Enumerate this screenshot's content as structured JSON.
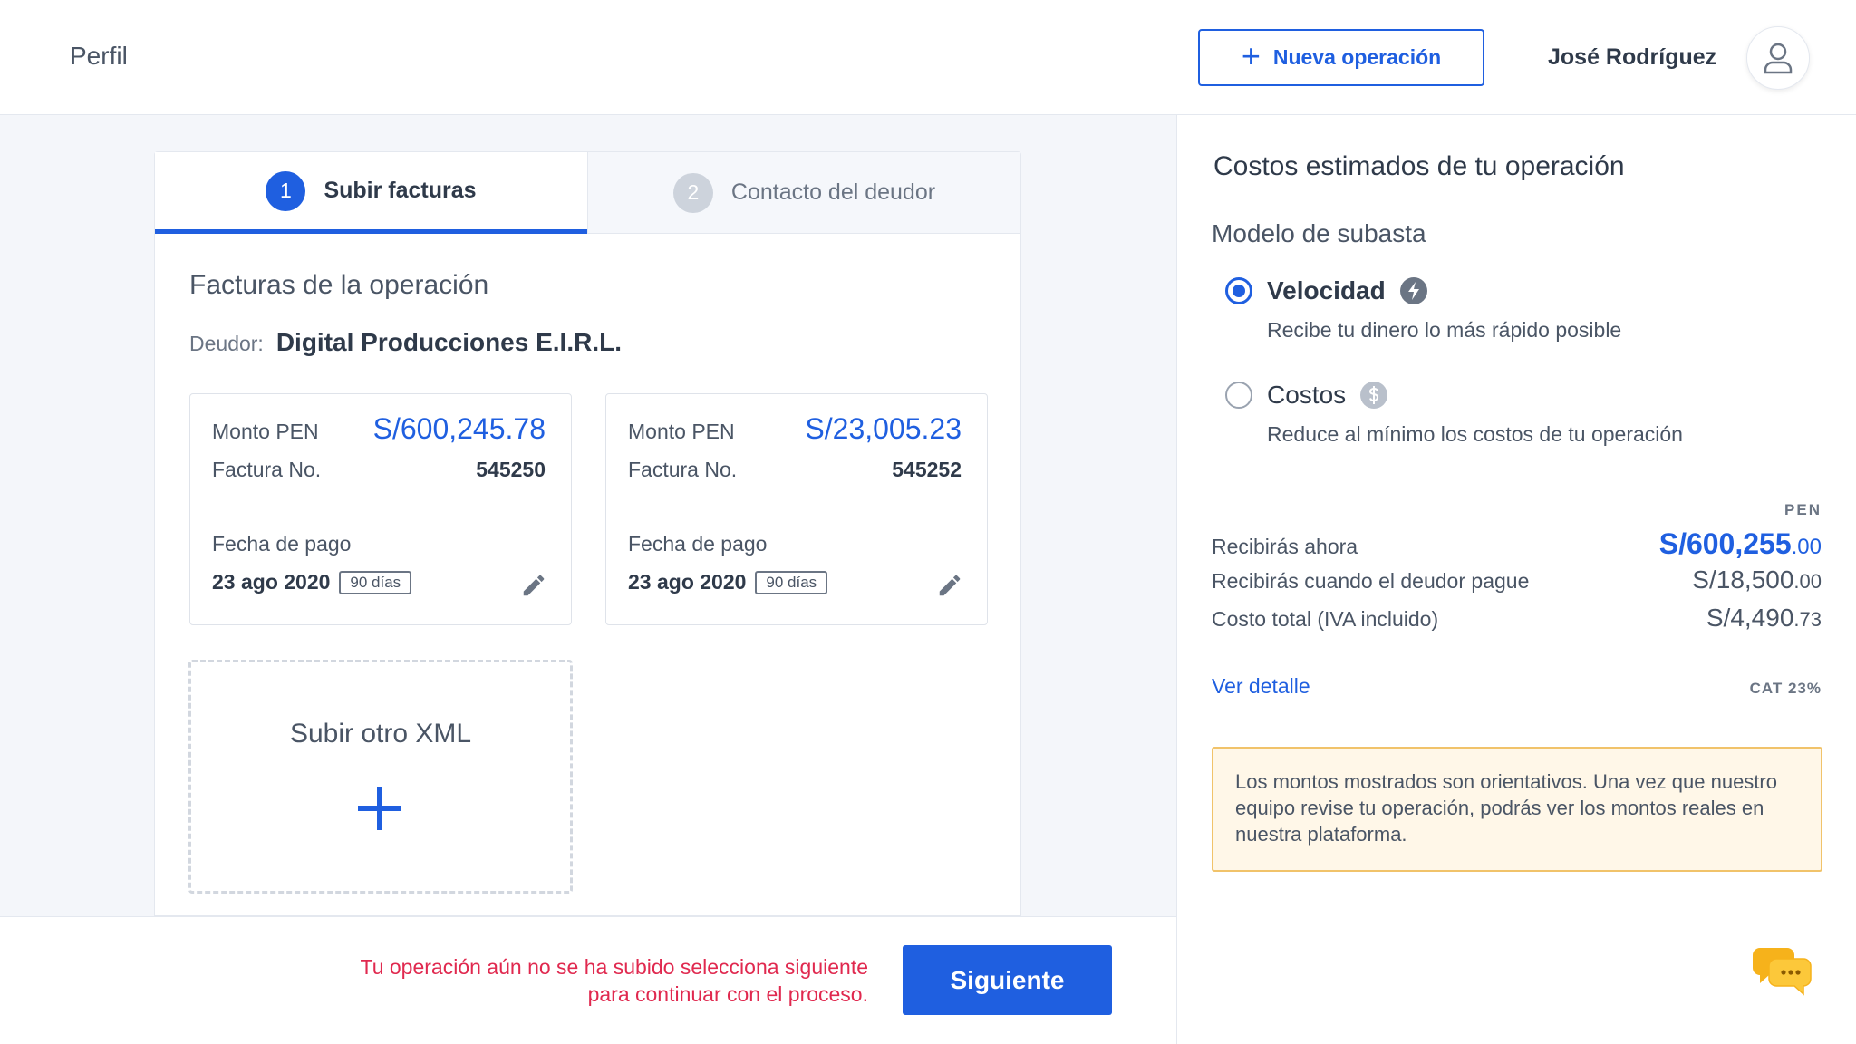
{
  "header": {
    "profile_label": "Perfil",
    "new_operation_label": "Nueva operación",
    "user_name": "José Rodríguez",
    "accent_color": "#1f5fe0"
  },
  "steps": [
    {
      "number": "1",
      "label": "Subir facturas",
      "active": true
    },
    {
      "number": "2",
      "label": "Contacto del deudor",
      "active": false
    }
  ],
  "main": {
    "section_title": "Facturas de la operación",
    "debtor_label": "Deudor:",
    "debtor_name": "Digital Producciones E.I.R.L.",
    "invoices": [
      {
        "amount_label": "Monto PEN",
        "amount": "S/600,245.78",
        "number_label": "Factura No.",
        "number": "545250",
        "pay_label": "Fecha de pago",
        "pay_date": "23 ago 2020",
        "days": "90 días"
      },
      {
        "amount_label": "Monto PEN",
        "amount": "S/23,005.23",
        "number_label": "Factura No.",
        "number": "545252",
        "pay_label": "Fecha de pago",
        "pay_date": "23 ago 2020",
        "days": "90 días"
      }
    ],
    "upload_label": "Subir otro XML"
  },
  "footer": {
    "warning_line1": "Tu operación aún no se ha subido selecciona siguiente",
    "warning_line2": "para continuar con el proceso.",
    "next_label": "Siguiente",
    "warning_color": "#e0294f"
  },
  "side": {
    "title": "Costos estimados de tu operación",
    "model_title": "Modelo de subasta",
    "options": [
      {
        "name": "Velocidad",
        "desc": "Recibe tu dinero lo más rápido posible",
        "selected": true,
        "icon": "lightning-icon"
      },
      {
        "name": "Costos",
        "desc": "Reduce al mínimo los costos de tu operación",
        "selected": false,
        "icon": "dollar-icon"
      }
    ],
    "currency": "PEN",
    "rows": [
      {
        "label": "Recibirás ahora",
        "value": "S/600,255",
        "cents": ".00"
      },
      {
        "label": "Recibirás cuando el deudor pague",
        "value": "S/18,500",
        "cents": ".00"
      },
      {
        "label": "Costo total (IVA incluido)",
        "value": "S/4,490",
        "cents": ".73"
      }
    ],
    "detail_link": "Ver detalle",
    "cat": "CAT 23%",
    "notice": "Los montos mostrados son orientativos. Una vez que nuestro equipo revise tu operación, podrás ver los montos reales en nuestra plataforma."
  }
}
